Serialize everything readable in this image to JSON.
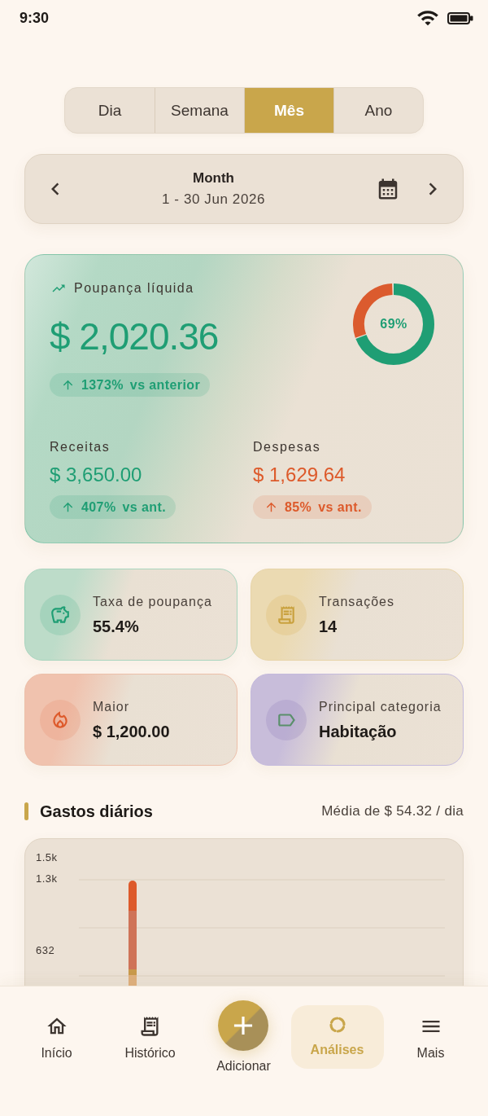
{
  "status_bar": {
    "time": "9:30"
  },
  "period_tabs": [
    {
      "label": "Dia",
      "selected": false
    },
    {
      "label": "Semana",
      "selected": false
    },
    {
      "label": "Mês",
      "selected": true
    },
    {
      "label": "Ano",
      "selected": false
    }
  ],
  "date_navigator": {
    "title": "Month",
    "range": "1 - 30 Jun 2026"
  },
  "net_savings": {
    "label": "Poupança líquida",
    "amount": "$ 2,020.36",
    "change": {
      "value": "1373%",
      "suffix": "vs anterior"
    },
    "ratio": {
      "level": 0.69,
      "label": "69%"
    },
    "breakdown": [
      {
        "kind": "income",
        "label": "Receitas",
        "amount": "$ 3,650.00",
        "change": {
          "value": "407%",
          "suffix": "vs ant."
        }
      },
      {
        "kind": "expense",
        "label": "Despesas",
        "amount": "$ 1,629.64",
        "change": {
          "value": "85%",
          "suffix": "vs ant."
        }
      }
    ]
  },
  "stats": [
    {
      "kind": "savings-rate",
      "label": "Taxa de poupança",
      "value": "55.4%"
    },
    {
      "kind": "transactions",
      "label": "Transações",
      "value": "14"
    },
    {
      "kind": "largest",
      "label": "Maior",
      "value": "$ 1,200.00"
    },
    {
      "kind": "category",
      "label": "Principal categoria",
      "value": "Habitação"
    }
  ],
  "daily_spending": {
    "title": "Gastos diários",
    "average": "Média de $ 54.32 / dia",
    "y_axis_labels": [
      "1.5k",
      "1.3k",
      "632"
    ]
  },
  "bottom_nav": [
    {
      "kind": "tab",
      "label": "Início",
      "selected": false
    },
    {
      "kind": "tab",
      "label": "Histórico",
      "selected": false
    },
    {
      "kind": "action",
      "label": "Adicionar",
      "selected": false
    },
    {
      "kind": "tab",
      "label": "Análises",
      "selected": true
    },
    {
      "kind": "tab",
      "label": "Mais",
      "selected": false
    }
  ]
}
